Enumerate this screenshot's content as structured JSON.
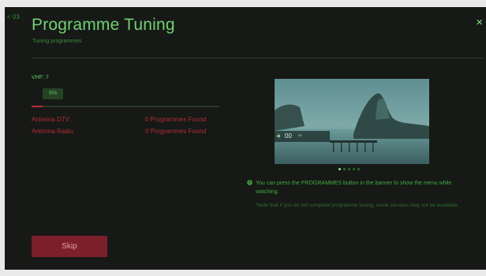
{
  "header": {
    "back_label": "< 03",
    "title": "Programme Tuning",
    "subtitle": "Tuning programmes",
    "close_label": "×"
  },
  "tuning": {
    "band": "VHF: 7",
    "progress_label": "6%",
    "progress": 0.06,
    "rows": [
      {
        "label": "Antenna DTV",
        "value": "0 Programmes Found"
      },
      {
        "label": "Antenna Radio",
        "value": "0 Programmes Found"
      }
    ]
  },
  "preview": {
    "banner_channel": "00",
    "banner_sub": "00",
    "page_count": 5,
    "active_page": 1
  },
  "tip": {
    "text": "You can press the PROGRAMMES button in the banner to show the menu while watching.",
    "note": "*Note that if you do not complete programme tuning, some services may not be available."
  },
  "actions": {
    "skip_label": "Skip"
  },
  "colors": {
    "accent": "#6fd26f",
    "warning": "#b22c38",
    "button": "#7c1f2a"
  }
}
